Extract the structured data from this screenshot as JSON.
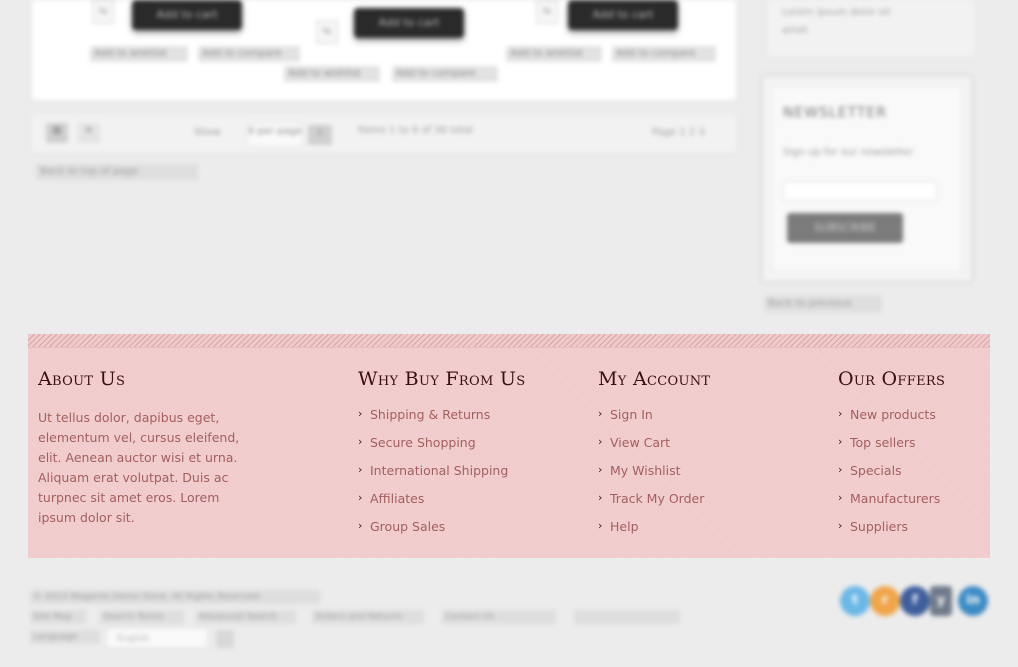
{
  "products": [
    {
      "button_label": "Add to cart",
      "links": [
        "Add to wishlist",
        "Add to compare"
      ]
    },
    {
      "button_label": "Add to cart",
      "links": [
        "Add to wishlist",
        "Add to compare"
      ]
    },
    {
      "button_label": "Add to cart",
      "links": [
        "Add to wishlist",
        "Add to compare"
      ]
    }
  ],
  "listing": {
    "show_label": "Show",
    "per_page": "9 per page",
    "items_info": "Items 1 to 9 of 30 total",
    "pages": "Page 1 2 3"
  },
  "breadcrumb": "Back to top of page",
  "sidebar": {
    "top_text": "Lorem ipsum dolor sit amet",
    "newsletter_title": "NEWSLETTER",
    "newsletter_label": "Sign up for our newsletter",
    "newsletter_button": "SUBSCRIBE",
    "link": "Back to previous"
  },
  "footer": {
    "about": {
      "title": "About Us",
      "text": "Ut tellus dolor, dapibus eget, elementum vel, cursus eleifend, elit. Aenean auctor wisi et urna. Aliquam erat volutpat. Duis ac turpnec sit amet eros. Lorem ipsum dolor sit."
    },
    "why": {
      "title": "Why Buy From Us",
      "items": [
        "Shipping & Returns",
        "Secure Shopping",
        "International Shipping",
        "Affiliates",
        "Group Sales"
      ]
    },
    "account": {
      "title": "My Account",
      "items": [
        "Sign In",
        "View Cart",
        "My Wishlist",
        "Track My Order",
        "Help"
      ]
    },
    "offers": {
      "title": "Our Offers",
      "items": [
        "New products",
        "Top sellers",
        "Specials",
        "Manufacturers",
        "Suppliers"
      ]
    }
  },
  "bottom": {
    "copyright": "© 2013 Magento Demo Store. All Rights Reserved.",
    "links": [
      "Site Map",
      "Search Terms",
      "Advanced Search",
      "Orders and Returns",
      "Contact Us"
    ],
    "language_label": "Language",
    "language_value": "English"
  },
  "social": [
    {
      "name": "twitter",
      "glyph": "t",
      "color": "#6bb7e6"
    },
    {
      "name": "rss",
      "glyph": "r",
      "color": "#f0a54a"
    },
    {
      "name": "facebook",
      "glyph": "f",
      "color": "#3f5e9c"
    },
    {
      "name": "youtube",
      "glyph": "y",
      "color": "#6f7a8a"
    },
    {
      "name": "linkedin",
      "glyph": "in",
      "color": "#3c8ac4"
    }
  ]
}
